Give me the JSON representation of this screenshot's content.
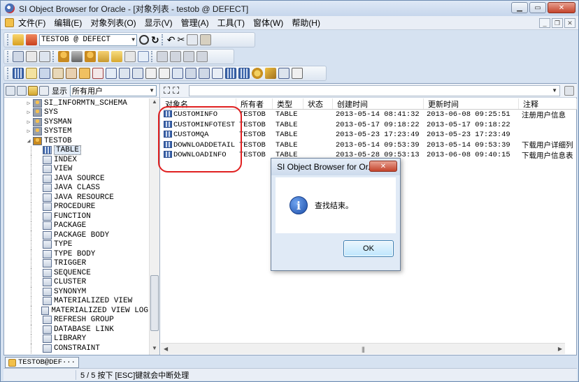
{
  "window": {
    "title": "SI Object Browser for Oracle - [对象列表 - testob @ DEFECT]",
    "min": "▁",
    "max": "▭",
    "close": "✕"
  },
  "menu": [
    "文件(F)",
    "编辑(E)",
    "对象列表(O)",
    "显示(V)",
    "管理(A)",
    "工具(T)",
    "窗体(W)",
    "帮助(H)"
  ],
  "mdi": {
    "min": "_",
    "restore": "❐",
    "close": "✕"
  },
  "toolbar": {
    "connection": "TESTOB @ DEFECT"
  },
  "left": {
    "display_label": "显示",
    "display_value": "所有用户",
    "tree": [
      {
        "label": "SI_INFORMTN_SCHEMA",
        "level": 1,
        "icon": "user-icon",
        "expander": "▷"
      },
      {
        "label": "SYS",
        "level": 1,
        "icon": "user-icon",
        "expander": "▷"
      },
      {
        "label": "SYSMAN",
        "level": 1,
        "icon": "user-icon",
        "expander": "▷"
      },
      {
        "label": "SYSTEM",
        "level": 1,
        "icon": "user-icon",
        "expander": "▷"
      },
      {
        "label": "TESTOB",
        "level": 1,
        "icon": "user-open-icon",
        "expander": "◢"
      },
      {
        "label": "TABLE",
        "level": 2,
        "icon": "table-icon",
        "expander": "",
        "selected": true
      },
      {
        "label": "INDEX",
        "level": 2,
        "icon": "index-icon",
        "expander": ""
      },
      {
        "label": "VIEW",
        "level": 2,
        "icon": "view-icon",
        "expander": ""
      },
      {
        "label": "JAVA SOURCE",
        "level": 2,
        "icon": "java-source-icon",
        "expander": ""
      },
      {
        "label": "JAVA CLASS",
        "level": 2,
        "icon": "java-class-icon",
        "expander": ""
      },
      {
        "label": "JAVA RESOURCE",
        "level": 2,
        "icon": "java-resource-icon",
        "expander": ""
      },
      {
        "label": "PROCEDURE",
        "level": 2,
        "icon": "procedure-icon",
        "expander": ""
      },
      {
        "label": "FUNCTION",
        "level": 2,
        "icon": "function-icon",
        "expander": ""
      },
      {
        "label": "PACKAGE",
        "level": 2,
        "icon": "package-icon",
        "expander": ""
      },
      {
        "label": "PACKAGE BODY",
        "level": 2,
        "icon": "package-body-icon",
        "expander": ""
      },
      {
        "label": "TYPE",
        "level": 2,
        "icon": "type-icon",
        "expander": ""
      },
      {
        "label": "TYPE BODY",
        "level": 2,
        "icon": "type-body-icon",
        "expander": ""
      },
      {
        "label": "TRIGGER",
        "level": 2,
        "icon": "trigger-icon",
        "expander": ""
      },
      {
        "label": "SEQUENCE",
        "level": 2,
        "icon": "sequence-icon",
        "expander": ""
      },
      {
        "label": "CLUSTER",
        "level": 2,
        "icon": "cluster-icon",
        "expander": ""
      },
      {
        "label": "SYNONYM",
        "level": 2,
        "icon": "synonym-icon",
        "expander": ""
      },
      {
        "label": "MATERIALIZED VIEW",
        "level": 2,
        "icon": "materialized-view-icon",
        "expander": ""
      },
      {
        "label": "MATERIALIZED VIEW LOG",
        "level": 2,
        "icon": "materialized-view-log-icon",
        "expander": ""
      },
      {
        "label": "REFRESH GROUP",
        "level": 2,
        "icon": "refresh-group-icon",
        "expander": ""
      },
      {
        "label": "DATABASE LINK",
        "level": 2,
        "icon": "database-link-icon",
        "expander": ""
      },
      {
        "label": "LIBRARY",
        "level": 2,
        "icon": "library-icon",
        "expander": ""
      },
      {
        "label": "CONSTRAINT",
        "level": 2,
        "icon": "constraint-icon",
        "expander": ""
      }
    ]
  },
  "grid": {
    "columns": [
      "对象名",
      "所有者",
      "类型",
      "状态",
      "创建时间",
      "更新时间",
      "注释"
    ],
    "rows": [
      [
        "CUSTOMINFO",
        "TESTOB",
        "TABLE",
        "",
        "2013-05-14 08:41:32",
        "2013-06-08 09:25:51",
        "注册用户信息"
      ],
      [
        "CUSTOMINFOTEST",
        "TESTOB",
        "TABLE",
        "",
        "2013-05-17 09:18:22",
        "2013-05-17 09:18:22",
        ""
      ],
      [
        "CUSTOMQA",
        "TESTOB",
        "TABLE",
        "",
        "2013-05-23 17:23:49",
        "2013-05-23 17:23:49",
        ""
      ],
      [
        "DOWNLOADDETAIL",
        "TESTOB",
        "TABLE",
        "",
        "2013-05-14 09:53:39",
        "2013-05-14 09:53:39",
        "下载用户详细列"
      ],
      [
        "DOWNLOADINFO",
        "TESTOB",
        "TABLE",
        "",
        "2013-05-28 09:53:13",
        "2013-06-08 09:40:15",
        "下载用户信息表"
      ]
    ]
  },
  "dialog": {
    "title": "SI Object Browser for Or...",
    "message": "查找结束。",
    "ok": "OK",
    "close": "✕"
  },
  "tab": {
    "label": "TESTOB@DEF···"
  },
  "status": {
    "text": "5 / 5 按下 [ESC]键就会中断处理"
  },
  "colors": {
    "highlight": "#e02020",
    "accent": "#3a62a8"
  }
}
